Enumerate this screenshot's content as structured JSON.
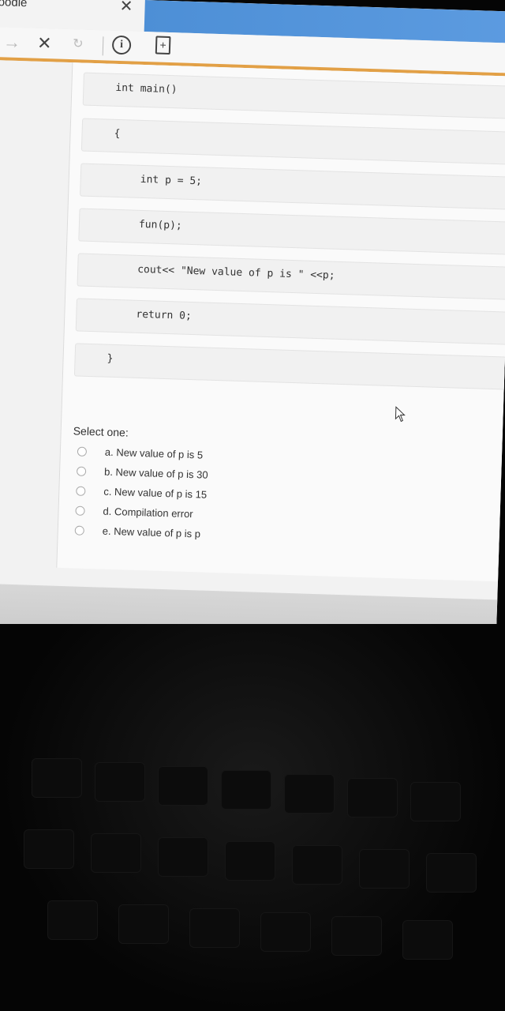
{
  "browser": {
    "tab_title": "oodle",
    "tab_close": "✕",
    "nav": {
      "forward": "→",
      "stop": "✕",
      "reload": "↻",
      "info": "i",
      "page_action": "+"
    }
  },
  "code_lines": [
    "int main()",
    "{",
    "int p = 5;",
    "fun(p);",
    "cout<< \"New value of p is \" <<p;",
    "return 0;",
    "}"
  ],
  "question": {
    "prompt": "Select one:",
    "options": [
      "a. New value of p is 5",
      "b. New value of p is 30",
      "c. New value of p is 15",
      "d. Compilation error",
      "e. New value of p is p"
    ]
  },
  "icons": {
    "info": "info-icon",
    "page": "page-icon",
    "cursor": "mouse-cursor-icon"
  },
  "colors": {
    "accent_tab": "#4d8fd6",
    "orange_rule": "#e2a046"
  }
}
